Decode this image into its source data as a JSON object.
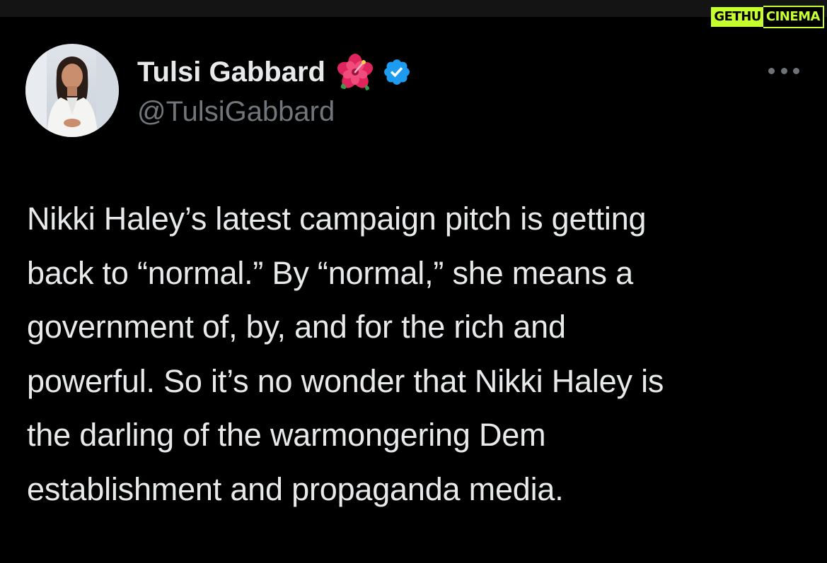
{
  "watermark": {
    "part1": "GETHU",
    "part2": "CINEMA",
    "accent_color": "#c7ff2e"
  },
  "tweet": {
    "author_name": "Tulsi Gabbard",
    "name_emoji_icon": "hibiscus-icon",
    "verified_icon": "verified-badge-icon",
    "verified_color": "#1d9bf0",
    "handle": "@TulsiGabbard",
    "more_icon": "more-horizontal-icon",
    "text": "Nikki Haley’s latest campaign pitch is getting\nback to “normal.” By “normal,” she means a\ngovernment of, by, and for the rich and\npowerful. So it’s no wonder that Nikki Haley is\nthe darling of the warmongering Dem\nestablishment and propaganda media."
  },
  "theme": {
    "background": "#000000",
    "text_primary": "#e7e9ea",
    "text_secondary": "#71767b"
  }
}
